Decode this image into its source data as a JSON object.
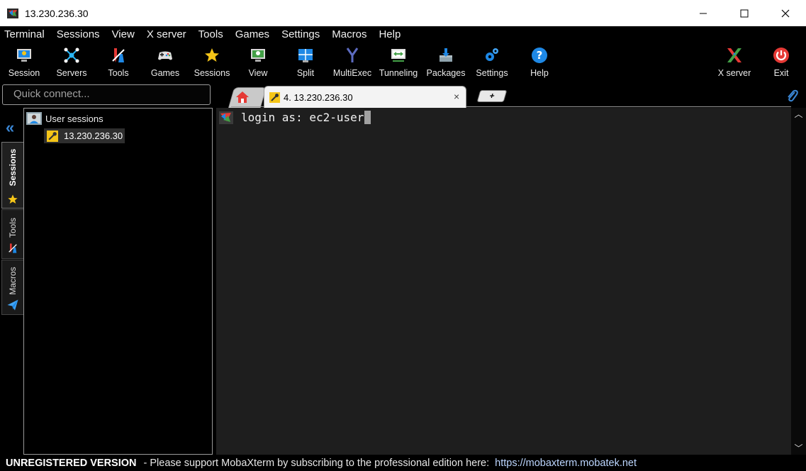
{
  "window": {
    "title": "13.230.236.30"
  },
  "menu": [
    "Terminal",
    "Sessions",
    "View",
    "X server",
    "Tools",
    "Games",
    "Settings",
    "Macros",
    "Help"
  ],
  "toolbar": {
    "session": "Session",
    "servers": "Servers",
    "tools": "Tools",
    "games": "Games",
    "sessions": "Sessions",
    "view": "View",
    "split": "Split",
    "multiexec": "MultiExec",
    "tunneling": "Tunneling",
    "packages": "Packages",
    "settings": "Settings",
    "help": "Help",
    "xserver": "X server",
    "exit": "Exit"
  },
  "quick_connect": {
    "placeholder": "Quick connect..."
  },
  "tabs": {
    "active_label": "4. 13.230.236.30",
    "close_glyph": "×",
    "plus_glyph": "+"
  },
  "side_tabs": {
    "sessions": "Sessions",
    "tools": "Tools",
    "macros": "Macros"
  },
  "tree": {
    "root": "User sessions",
    "child": "13.230.236.30"
  },
  "terminal": {
    "line": "login as: ec2-user"
  },
  "status": {
    "unregistered": "UNREGISTERED VERSION",
    "message": "-  Please support MobaXterm by subscribing to the professional edition here:",
    "link": "https://mobaxterm.mobatek.net"
  },
  "colors": {
    "accent_blue": "#3a86d4",
    "exit_red": "#e53935",
    "star_yellow": "#f5c518",
    "terminal_bg": "#1e1e1e"
  }
}
